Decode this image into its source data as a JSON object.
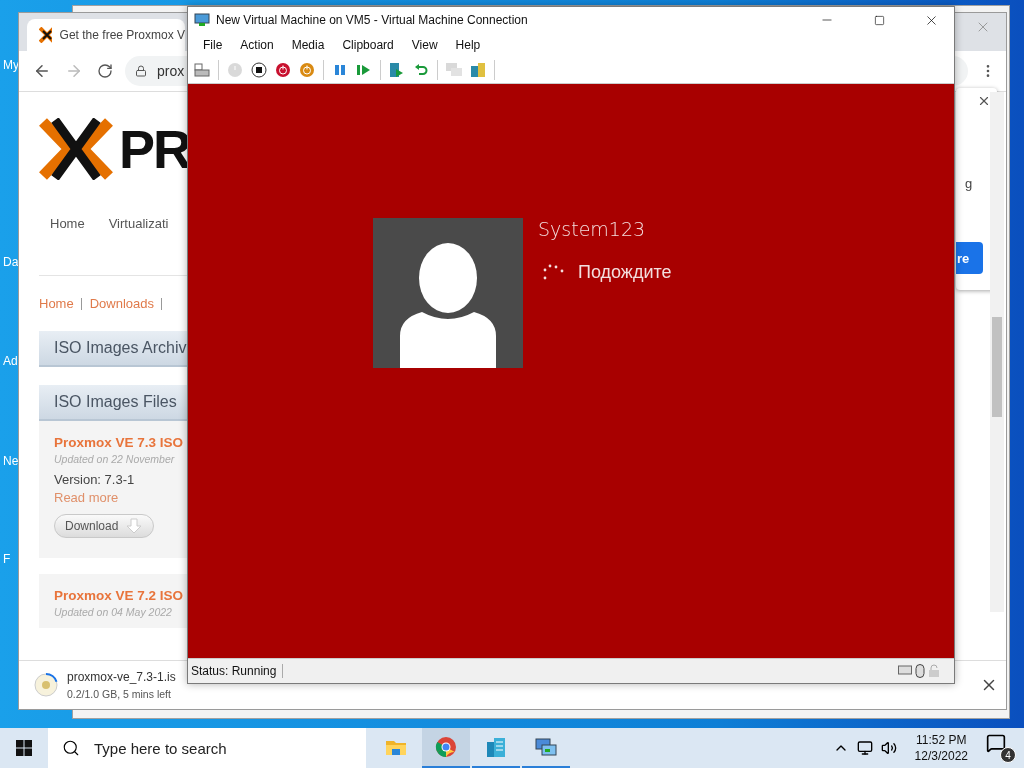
{
  "desktop": {
    "icon_labels": [
      "My",
      "Da",
      "Ad",
      "Ne",
      "F"
    ]
  },
  "browser": {
    "tab": {
      "title": "Get the free Proxmox V"
    },
    "address": "prox",
    "logo_text": "PR",
    "nav": [
      {
        "label": "Home"
      },
      {
        "label": "Virtualizati"
      }
    ],
    "breadcrumb": [
      "Home",
      "Downloads"
    ],
    "archive_header": "ISO Images Archiv",
    "files_header": "ISO Images Files",
    "items": [
      {
        "title": "Proxmox VE 7.3 ISO",
        "updated": "Updated on 22 November",
        "version": "Version: 7.3-1",
        "read_more": "Read more",
        "button": "Download"
      },
      {
        "title": "Proxmox VE 7.2 ISO",
        "updated": "Updated on 04 May 2022"
      }
    ],
    "popup": {
      "text": "g",
      "button": "re"
    },
    "download": {
      "filename": "proxmox-ve_7.3-1.is",
      "progress": "0.2/1.0 GB, 5 mins left",
      "level": 0.2
    }
  },
  "vm_window": {
    "title": "New Virtual Machine on VM5 - Virtual Machine Connection",
    "menu": [
      "File",
      "Action",
      "Media",
      "Clipboard",
      "View",
      "Help"
    ],
    "toolbar": [
      {
        "kind": "ctrlaltdel"
      },
      {
        "kind": "sep"
      },
      {
        "kind": "start",
        "disabled": true
      },
      {
        "kind": "turnoff",
        "disabled": false
      },
      {
        "kind": "shutdown",
        "disabled": false
      },
      {
        "kind": "save",
        "disabled": false
      },
      {
        "kind": "sep"
      },
      {
        "kind": "pause",
        "disabled": false
      },
      {
        "kind": "reset",
        "disabled": false
      },
      {
        "kind": "sep"
      },
      {
        "kind": "checkpoint",
        "disabled": false
      },
      {
        "kind": "revert",
        "disabled": false
      },
      {
        "kind": "sep"
      },
      {
        "kind": "enhanced",
        "disabled": true
      },
      {
        "kind": "share",
        "disabled": false
      },
      {
        "kind": "sep"
      }
    ],
    "user_name": "System123",
    "status_text": "Подождите",
    "status_bar": "Status: Running"
  },
  "taskbar": {
    "search": {
      "placeholder": "Type here to search"
    },
    "apps": [
      {
        "kind": "explorer",
        "selected": false,
        "running": false
      },
      {
        "kind": "chrome",
        "selected": true,
        "running": true
      },
      {
        "kind": "server",
        "selected": false,
        "running": true
      },
      {
        "kind": "vmconnect",
        "selected": false,
        "running": true
      }
    ],
    "time": "11:52 PM",
    "date": "12/3/2022",
    "notifications": "4"
  }
}
